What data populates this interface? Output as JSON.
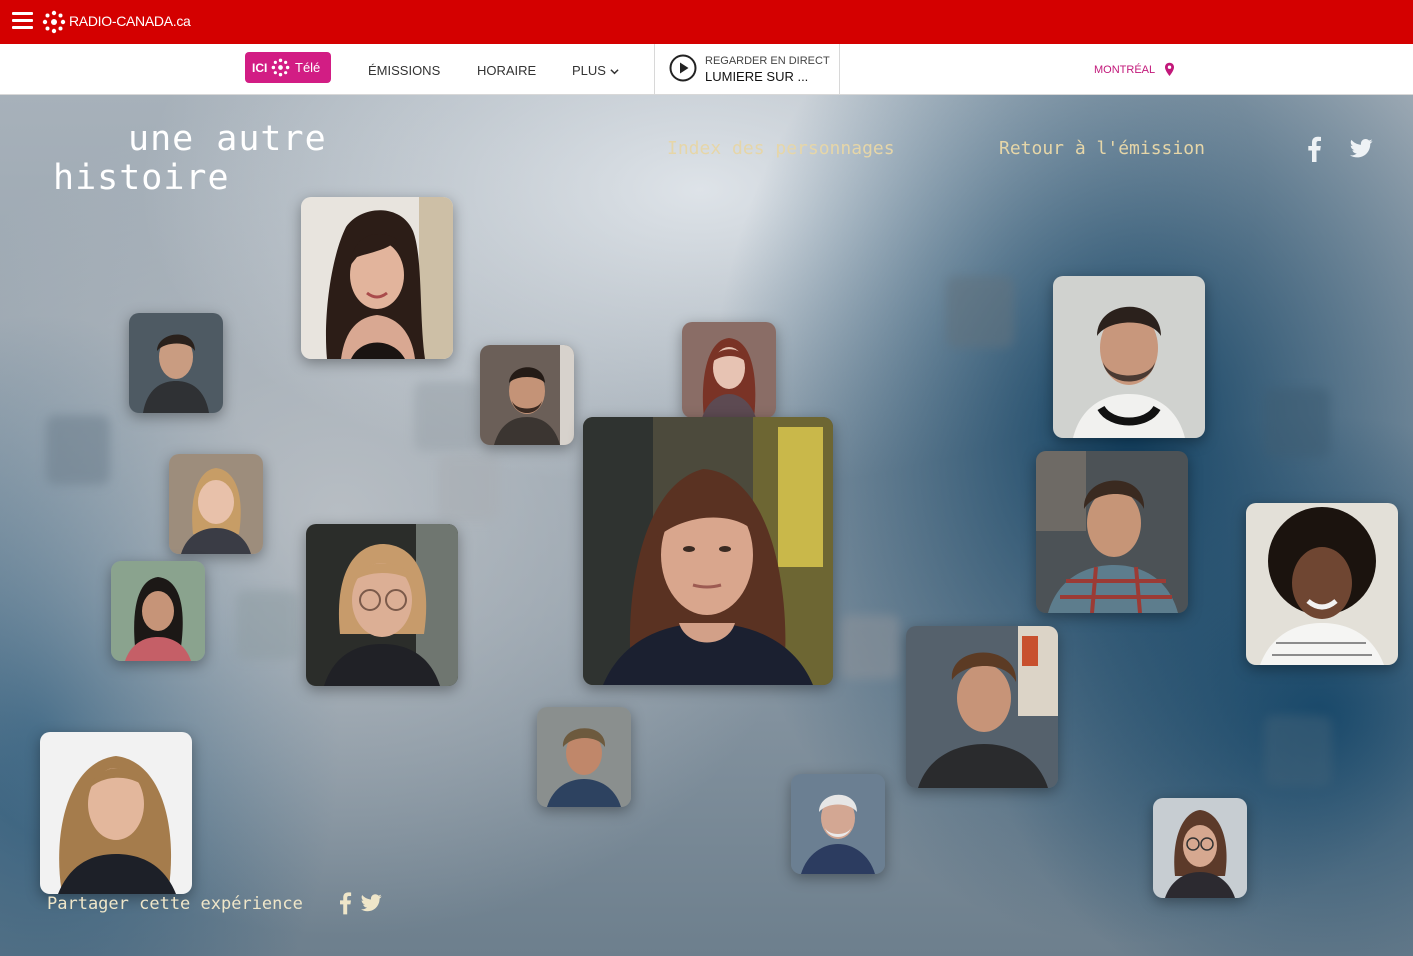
{
  "topbar": {
    "menu_icon": "hamburger-menu-icon",
    "logo_icon": "radio-canada-gem-icon",
    "site_name": "RADIO-CANADA.ca",
    "background": "#d40000"
  },
  "nav": {
    "brand_prefix": "ICI",
    "brand_name": "Télé",
    "brand_color": "#d21d84",
    "items": [
      {
        "label": "ÉMISSIONS"
      },
      {
        "label": "HORAIRE"
      },
      {
        "label": "PLUS"
      }
    ],
    "live": {
      "label": "REGARDER EN DIRECT",
      "show": "LUMIERE SUR ..."
    },
    "city": "MONTRÉAL",
    "city_icon": "location-pin-icon"
  },
  "hero": {
    "title_line1": "une autre",
    "title_line2": "histoire",
    "links": {
      "index": "Index des personnages",
      "retour": "Retour à l'émission"
    },
    "social_icons": [
      "facebook-icon",
      "twitter-icon"
    ],
    "share_text": "Partager cette expérience",
    "link_color": "#e6d6a8"
  },
  "portraits": [
    {
      "id": "woman-dark-hair-smiling"
    },
    {
      "id": "man-dark-hair"
    },
    {
      "id": "man-beard-short-hair"
    },
    {
      "id": "young-woman-red-hair"
    },
    {
      "id": "woman-center-featured"
    },
    {
      "id": "man-stubble-grey"
    },
    {
      "id": "woman-blonde-round"
    },
    {
      "id": "woman-red-glasses"
    },
    {
      "id": "girl-dark-hair"
    },
    {
      "id": "young-man-plaid"
    },
    {
      "id": "woman-curly-hair"
    },
    {
      "id": "man-messy-hair"
    },
    {
      "id": "woman-blonde-long"
    },
    {
      "id": "man-older-scruffy"
    },
    {
      "id": "man-white-hair"
    },
    {
      "id": "woman-glasses-short"
    }
  ]
}
